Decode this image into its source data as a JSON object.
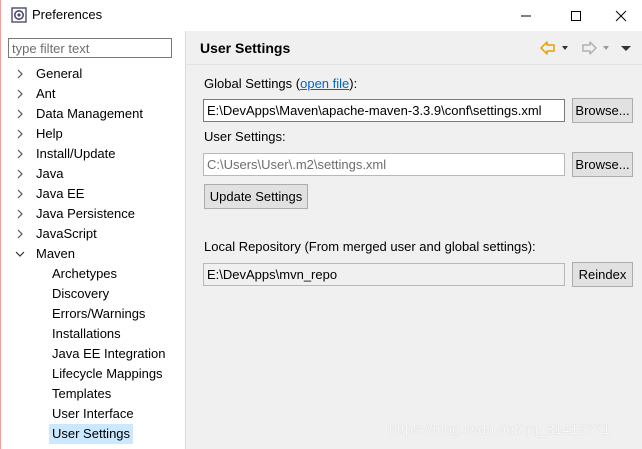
{
  "window": {
    "title": "Preferences",
    "minimize_glyph": "—",
    "maximize_glyph": "☐",
    "close_glyph": "✕"
  },
  "sidebar": {
    "filter_placeholder": "type filter text",
    "items": [
      {
        "label": "General",
        "expanded": false
      },
      {
        "label": "Ant",
        "expanded": false
      },
      {
        "label": "Data Management",
        "expanded": false
      },
      {
        "label": "Help",
        "expanded": false
      },
      {
        "label": "Install/Update",
        "expanded": false
      },
      {
        "label": "Java",
        "expanded": false
      },
      {
        "label": "Java EE",
        "expanded": false
      },
      {
        "label": "Java Persistence",
        "expanded": false
      },
      {
        "label": "JavaScript",
        "expanded": false
      },
      {
        "label": "Maven",
        "expanded": true
      }
    ],
    "children": [
      {
        "label": "Archetypes"
      },
      {
        "label": "Discovery"
      },
      {
        "label": "Errors/Warnings"
      },
      {
        "label": "Installations"
      },
      {
        "label": "Java EE Integration"
      },
      {
        "label": "Lifecycle Mappings"
      },
      {
        "label": "Templates"
      },
      {
        "label": "User Interface"
      },
      {
        "label": "User Settings",
        "selected": true
      }
    ]
  },
  "page": {
    "title": "User Settings",
    "global_label_prefix": "Global Settings (",
    "global_link": "open file",
    "global_label_suffix": "):",
    "global_value": "E:\\DevApps\\Maven\\apache-maven-3.3.9\\conf\\settings.xml",
    "browse_global": "Browse...",
    "user_label": "User Settings:",
    "user_value": "C:\\Users\\User\\.m2\\settings.xml",
    "browse_user": "Browse...",
    "update_button": "Update Settings",
    "local_repo_label": "Local Repository (From merged user and global settings):",
    "local_repo_value": "E:\\DevApps\\mvn_repo",
    "reindex_button": "Reindex"
  },
  "watermark": "https://blog.csdn.net/qq_31416771",
  "colors": {
    "selection": "#cce8ff",
    "link": "#0066cc",
    "nav_back_arrow": "#e8a000",
    "nav_fwd_arrow": "#b0b0b0"
  }
}
